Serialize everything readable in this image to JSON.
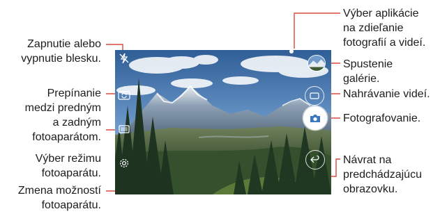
{
  "labels": {
    "flash": [
      "Zapnutie alebo",
      "vypnutie blesku."
    ],
    "swap": [
      "Prepínanie",
      "medzi predným",
      "a zadným",
      "fotoaparátom."
    ],
    "mode": [
      "Výber režimu",
      "fotoaparátu."
    ],
    "options": [
      "Zmena možností",
      "fotoaparátu."
    ],
    "share": [
      "Výber aplikácie",
      "na zdieľanie",
      "fotografií a videí."
    ],
    "gallery": [
      "Spustenie",
      "galérie."
    ],
    "record": [
      "Nahrávanie videí."
    ],
    "photo": [
      "Fotografovanie."
    ],
    "back": [
      "Návrat na",
      "predchádzajúcu",
      "obrazovku."
    ]
  },
  "colors": {
    "leader": "#d94a3d",
    "sky": "#5f8fc4",
    "mountain": "#6a8299",
    "forest": "#2f4a2c"
  },
  "icons": {
    "flash": "flash-off-icon",
    "swap": "camera-swap-icon",
    "mode": "camera-mode-icon",
    "options": "gear-icon",
    "share": "share-dot-icon",
    "gallery": "gallery-thumbnail",
    "record": "video-record-icon",
    "photo": "camera-icon",
    "back": "back-arrow-icon"
  }
}
